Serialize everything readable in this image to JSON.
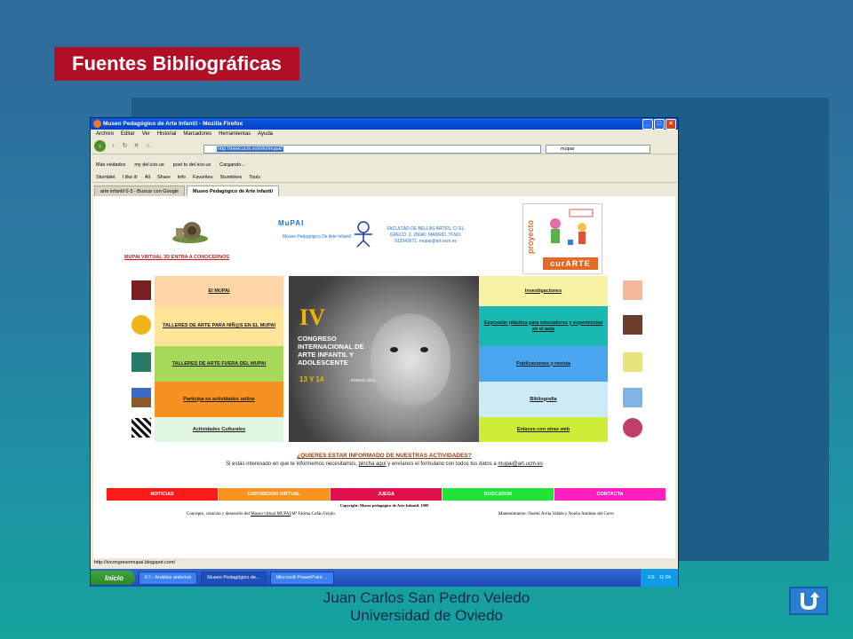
{
  "slide": {
    "title": "Fuentes Bibliográficas",
    "author": "Juan Carlos San Pedro Veledo",
    "institution": "Universidad de Oviedo"
  },
  "browser": {
    "window_title": "Museo Pedagógico de Arte Infantil - Mozilla Firefox",
    "menu": [
      "Archivo",
      "Editar",
      "Ver",
      "Historial",
      "Marcadores",
      "Herramientas",
      "Ayuda"
    ],
    "url": "http://www.ucm.es/info/mupai/",
    "search_value": "mupai",
    "bookmarks": [
      "Más visitados",
      "my del.icio.us",
      "post to del.icio.us",
      "Cargando..."
    ],
    "stumble_bar": [
      "StumbleI",
      "I like it!",
      "All",
      "Share",
      "Info",
      "Favorites",
      "Stumblers",
      "Tools"
    ],
    "tabs": [
      "arte infantil 0-3 - Buscar con Google",
      "Museo Pedagógico de Arte Infantil"
    ],
    "status": "http://ivcongresomupai.blogspot.com/"
  },
  "page": {
    "logo": "MuPAI",
    "logo_sub": "Museo Pedagógico De Arte Infantil",
    "faculty": "FACULTAD DE BELLAS ARTES. C/ EL GRECO, 2. 28040. MADRID. TFNO: 913943671. mupai@art.ucm.es",
    "virtual3d": "MUPAI VIRTUAL 3D ENTRA A CONOCERNOS",
    "proyecto": "proyecto",
    "curarte": "curARTE",
    "left_tiles": [
      {
        "label": "El MUPAI",
        "color": "#ffd5a8"
      },
      {
        "label": "TALLERES DE ARTE PARA NIÑ@S EN EL MUPAI",
        "color": "#ffe49a"
      },
      {
        "label": "TALLERES DE ARTE FUERA DEL MUPAI",
        "color": "#a6d85a"
      },
      {
        "label": "Participa en actividades online",
        "color": "#f7911f"
      },
      {
        "label": "Actividades Culturales",
        "color": "#e1f6de"
      }
    ],
    "right_tiles": [
      {
        "label": "Investigaciones",
        "color": "#f7f3a2"
      },
      {
        "label": "Expresión plástica para educadores y experiencias en el aula",
        "color": "#19b8b0"
      },
      {
        "label": "Publicaciones y revista",
        "color": "#4aa6ef"
      },
      {
        "label": "Bibliografia",
        "color": "#cdeaf7"
      },
      {
        "label": "Enlaces con otras web",
        "color": "#cdee37"
      }
    ],
    "congress": {
      "number": "IV",
      "text": "CONGRESO INTERNACIONAL DE ARTE INFANTIL Y ADOLESCENTE",
      "dates": "13 Y 14",
      "month_year": "ENERO 2010"
    },
    "info_title": "¿QUIERES ESTAR INFORMADO DE NUESTRAS ACTIVIDADES?",
    "info_pre": "Si estás interesado en que te informemos necesitamos,",
    "info_link": "pincha aquí",
    "info_mid": "y envíanos el formulario con todos tus datos a",
    "info_email": "mupai@art.ucm.es",
    "nav_strip": [
      {
        "label": "NOTICIAS",
        "color": "#ff1a1a"
      },
      {
        "label": "EXPOSICIÓN VIRTUAL",
        "color": "#f7931e"
      },
      {
        "label": "JUEGA",
        "color": "#e0104c"
      },
      {
        "label": "BUSCADOR",
        "color": "#22e33a"
      },
      {
        "label": "CONTACTA",
        "color": "#ff1fbf"
      }
    ],
    "copyright": "Copyright: Museo pedagógico de Arte Infantil. 1999",
    "credits_left_pre": "Concepto, creación y desarrollo del",
    "credits_left_link": "Museo virtual MUPAI",
    "credits_left_post": "Mª Fátima Cofán Feijóo",
    "credits_right": "Mantenimiento: Noemí Ávila Valdés y Noelia Antúnez del Cerro"
  },
  "taskbar": {
    "start": "Inicio",
    "tasks": [
      "E:\\ - Análisis antivirus",
      "Museo Pedagógico de...",
      "Microsoft PowerPoint ..."
    ],
    "lang": "ES",
    "clock": "11:04"
  },
  "colors": {
    "title_bg": "#b10f26",
    "return_button": "#2a7fd0"
  }
}
